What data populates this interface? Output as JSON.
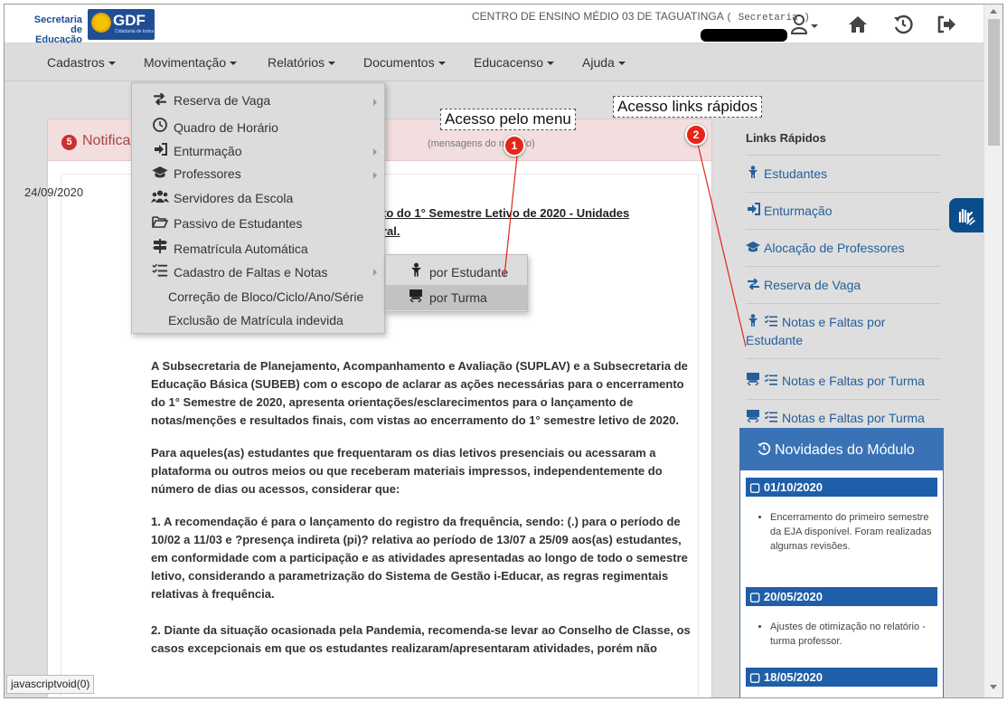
{
  "header": {
    "logo_secretaria": "Secretaria de Educação",
    "logo_gdf": "GDF",
    "logo_gdf_sub": "Cidadania de todos",
    "school_name": "CENTRO DE ENSINO MÉDIO 03 DE TAGUATINGA",
    "school_role": "( Secretaria )"
  },
  "nav": {
    "items": [
      "Cadastros",
      "Movimentação",
      "Relatórios",
      "Documentos",
      "Educacenso",
      "Ajuda"
    ]
  },
  "dropdown": {
    "items": [
      "Reserva de Vaga",
      "Quadro de Horário",
      "Enturmação",
      "Professores",
      "Servidores da Escola",
      "Passivo de Estudantes",
      "Rematrícula Automática",
      "Cadastro de Faltas e Notas",
      "Correção de Bloco/Ciclo/Ano/Série",
      "Exclusão de Matrícula indevida"
    ],
    "submenu": [
      "por Estudante",
      "por Turma"
    ]
  },
  "callouts": {
    "menu": "Acesso pelo menu",
    "links": "Acesso links rápidos",
    "badge1": "1",
    "badge2": "2"
  },
  "notifications": {
    "count": "5",
    "title": "Notificações",
    "hint": "mensagens do módulo)",
    "date": "24/09/2020",
    "ann_title_1": "to do 1° Semestre Letivo de 2020 - Unidades",
    "ann_title_2": "ral",
    "ann_title_2_tail": ".",
    "paragraphs": [
      "A Subsecretaria de Planejamento, Acompanhamento e Avaliação (SUPLAV) e a Subsecretaria de Educação Básica (SUBEB) com o escopo de aclarar as ações necessárias para o encerramento do 1° Semestre de 2020, apresenta orientações/esclarecimentos para o lançamento de notas/menções e resultados finais, com vistas ao encerramento do 1° semestre letivo de 2020.",
      "Para aqueles(as) estudantes que frequentaram os dias letivos presenciais ou acessaram a plataforma ou outros meios ou que receberam materiais impressos, independentemente do número de dias ou acessos, considerar que:",
      "1. A recomendação é para o lançamento do registro da frequência, sendo: (.) para o período de 10/02 a 11/03 e ?presença indireta (pi)? relativa ao período de 13/07 a 25/09 aos(as) estudantes, em conformidade com a participação e as atividades apresentadas ao longo de todo o semestre letivo, considerando a parametrização do Sistema de Gestão i-Educar, as regras regimentais relativas à frequência.",
      "2. Diante da situação ocasionada pela Pandemia, recomenda-se levar ao Conselho de Classe, os casos excepcionais em que os estudantes realizaram/apresentaram atividades, porém não"
    ]
  },
  "quick_links": {
    "title": "Links Rápidos",
    "items": [
      {
        "label": "Estudantes",
        "icon": "student-icon"
      },
      {
        "label": "Enturmação",
        "icon": "sign-in-icon"
      },
      {
        "label": "Alocação de Professores",
        "icon": "graduation-cap-icon"
      },
      {
        "label": "Reserva de Vaga",
        "icon": "exchange-icon"
      },
      {
        "label": "Notas e Faltas por Estudante",
        "icon": "student-checklist-icon"
      },
      {
        "label": "Notas e Faltas por Turma",
        "icon": "classroom-checklist-icon"
      },
      {
        "label": "Notas e Faltas por Turma",
        "icon": "classroom-checklist-icon"
      }
    ]
  },
  "news": {
    "title": "Novidades do Módulo",
    "entries": [
      {
        "date": "01/10/2020",
        "text": "Encerramento do primeiro semestre da EJA disponível. Foram realizadas algumas revisões."
      },
      {
        "date": "20/05/2020",
        "text": "Ajustes de otimização no relatório - turma professor."
      },
      {
        "date": "18/05/2020",
        "text": ""
      }
    ]
  },
  "statusbar": "javascriptvoid(0)"
}
